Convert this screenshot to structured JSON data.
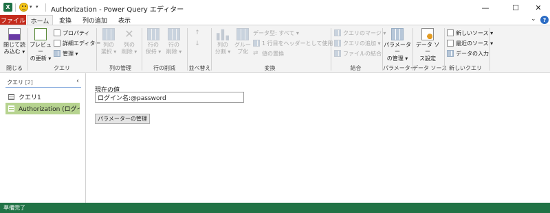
{
  "window": {
    "title": "Authorization - Power Query エディター",
    "minimize": "—",
    "maximize": "☐",
    "close": "✕",
    "qa_dropdown": "▾",
    "qa_customize": "▾"
  },
  "tabs": [
    {
      "label": "ファイル"
    },
    {
      "label": "ホーム"
    },
    {
      "label": "変換"
    },
    {
      "label": "列の追加"
    },
    {
      "label": "表示"
    }
  ],
  "ribbon_controls": {
    "collapse": "⌄",
    "help": "?"
  },
  "ribbon": {
    "groups": {
      "close": "閉じる",
      "query": "クエリ",
      "manage_columns": "列の管理",
      "reduce_rows": "行の削減",
      "sort": "並べ替え",
      "transform": "変換",
      "combine": "結合",
      "parameters": "パラメーター",
      "data_source": "データ ソース",
      "new_query": "新しいクエリ"
    },
    "buttons": {
      "close_load_1": "閉じて読",
      "close_load_2": "み込む ▾",
      "preview_refresh_1": "プレビュー",
      "preview_refresh_2": "の更新 ▾",
      "properties": "プロパティ",
      "advanced_editor": "詳細エディター",
      "manage": "管理 ▾",
      "choose_columns_1": "列の",
      "choose_columns_2": "選択 ▾",
      "remove_columns_1": "列の",
      "remove_columns_2": "削除 ▾",
      "keep_rows_1": "行の",
      "keep_rows_2": "保持 ▾",
      "remove_rows_1": "行の",
      "remove_rows_2": "削除 ▾",
      "split_column_1": "列の",
      "split_column_2": "分割 ▾",
      "group_by_1": "グルー",
      "group_by_2": "プ化",
      "data_type": "データ型: すべて ▾",
      "use_first_row": "1 行目をヘッダーとして使用 ▾",
      "replace_values": "値の置換",
      "merge_queries": "クエリのマージ ▾",
      "append_queries": "クエリの追加 ▾",
      "combine_files": "ファイルの結合",
      "manage_params_1": "パラメーター",
      "manage_params_2": "の管理 ▾",
      "data_source_settings_1": "データ ソー",
      "data_source_settings_2": "ス設定",
      "new_source": "新しいソース ▾",
      "recent_sources": "最近のソース ▾",
      "enter_data": "データの入力"
    }
  },
  "queries_pane": {
    "header": "クエリ",
    "count": "[2]",
    "collapse": "‹",
    "items": [
      {
        "label": "クエリ1"
      },
      {
        "label": "Authorization (ログイ..."
      }
    ]
  },
  "parameter": {
    "current_value_label": "現在の値",
    "current_value": "ログイン名:@password",
    "manage_button": "パラメーターの管理"
  },
  "status": {
    "text": "準備完了"
  },
  "colors": {
    "file_tab": "#c42b1c",
    "status_bar": "#217346",
    "selected_query": "#b6d38f",
    "ribbon_bg": "#f3f3f3"
  }
}
